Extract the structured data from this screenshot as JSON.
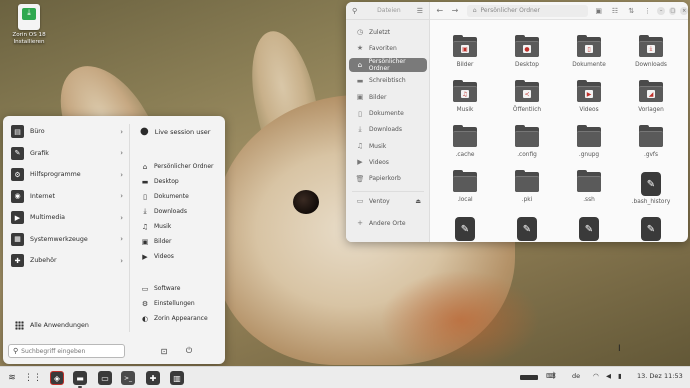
{
  "desktop_icon": {
    "label": "Zorin OS 18 Installieren",
    "glyph": "⤓"
  },
  "menu": {
    "categories": [
      {
        "label": "Büro",
        "icon": "office-icon",
        "glyph": "▤"
      },
      {
        "label": "Grafik",
        "icon": "graphics-icon",
        "glyph": "✎"
      },
      {
        "label": "Hilfsprogramme",
        "icon": "utilities-icon",
        "glyph": "⚙"
      },
      {
        "label": "Internet",
        "icon": "internet-icon",
        "glyph": "◉"
      },
      {
        "label": "Multimedia",
        "icon": "multimedia-icon",
        "glyph": "▶"
      },
      {
        "label": "Systemwerkzeuge",
        "icon": "system-tools-icon",
        "glyph": "▦"
      },
      {
        "label": "Zubehör",
        "icon": "accessories-icon",
        "glyph": "✚"
      }
    ],
    "all_apps_label": "Alle Anwendungen",
    "search_placeholder": "Suchbegriff eingeben",
    "user_label": "Live session user",
    "places": [
      {
        "label": "Persönlicher Ordner",
        "glyph": "⌂"
      },
      {
        "label": "Desktop",
        "glyph": "▬"
      },
      {
        "label": "Dokumente",
        "glyph": "▯"
      },
      {
        "label": "Downloads",
        "glyph": "⤓"
      },
      {
        "label": "Musik",
        "glyph": "♫"
      },
      {
        "label": "Bilder",
        "glyph": "▣"
      },
      {
        "label": "Videos",
        "glyph": "▶"
      }
    ],
    "system_items": [
      {
        "label": "Software",
        "glyph": "▭"
      },
      {
        "label": "Einstellungen",
        "glyph": "⚙"
      },
      {
        "label": "Zorin Appearance",
        "glyph": "◐"
      }
    ]
  },
  "file_manager": {
    "sidebar_title": "Dateien",
    "path": "Persönlicher Ordner",
    "sidebar": [
      {
        "label": "Zuletzt",
        "glyph": "◷",
        "active": false
      },
      {
        "label": "Favoriten",
        "glyph": "★",
        "active": false
      },
      {
        "label": "Persönlicher Ordner",
        "glyph": "⌂",
        "active": true
      },
      {
        "label": "Schreibtisch",
        "glyph": "▬",
        "active": false
      },
      {
        "label": "Bilder",
        "glyph": "▣",
        "active": false
      },
      {
        "label": "Dokumente",
        "glyph": "▯",
        "active": false
      },
      {
        "label": "Downloads",
        "glyph": "⤓",
        "active": false
      },
      {
        "label": "Musik",
        "glyph": "♫",
        "active": false
      },
      {
        "label": "Videos",
        "glyph": "▶",
        "active": false
      },
      {
        "label": "Papierkorb",
        "glyph": "🗑",
        "active": false
      }
    ],
    "devices": [
      {
        "label": "Ventoy",
        "glyph": "▭",
        "eject": "⏏"
      },
      {
        "label": "Andere Orte",
        "glyph": "+"
      }
    ],
    "files": [
      {
        "name": "Bilder",
        "type": "folder",
        "emblem": "▣"
      },
      {
        "name": "Desktop",
        "type": "folder",
        "emblem": "●"
      },
      {
        "name": "Dokumente",
        "type": "folder",
        "emblem": "▯"
      },
      {
        "name": "Downloads",
        "type": "folder",
        "emblem": "⤓"
      },
      {
        "name": "Musik",
        "type": "folder",
        "emblem": "♫"
      },
      {
        "name": "Öffentlich",
        "type": "folder",
        "emblem": "≺"
      },
      {
        "name": "Videos",
        "type": "folder",
        "emblem": "▶"
      },
      {
        "name": "Vorlagen",
        "type": "folder",
        "emblem": "◢"
      },
      {
        "name": ".cache",
        "type": "folder",
        "emblem": ""
      },
      {
        "name": ".config",
        "type": "folder",
        "emblem": ""
      },
      {
        "name": ".gnupg",
        "type": "folder",
        "emblem": ""
      },
      {
        "name": ".gvfs",
        "type": "folder",
        "emblem": ""
      },
      {
        "name": ".local",
        "type": "folder",
        "emblem": ""
      },
      {
        "name": ".pki",
        "type": "folder",
        "emblem": ""
      },
      {
        "name": ".ssh",
        "type": "folder",
        "emblem": ""
      },
      {
        "name": ".bash_history",
        "type": "file",
        "emblem": "✎"
      },
      {
        "name": "",
        "type": "file",
        "emblem": "✎"
      },
      {
        "name": "",
        "type": "file",
        "emblem": "✎"
      },
      {
        "name": "",
        "type": "file",
        "emblem": "✎"
      },
      {
        "name": "",
        "type": "file",
        "emblem": "✎"
      }
    ]
  },
  "taskbar": {
    "lang": "de",
    "date": "13. Dez",
    "time": "11:53"
  }
}
